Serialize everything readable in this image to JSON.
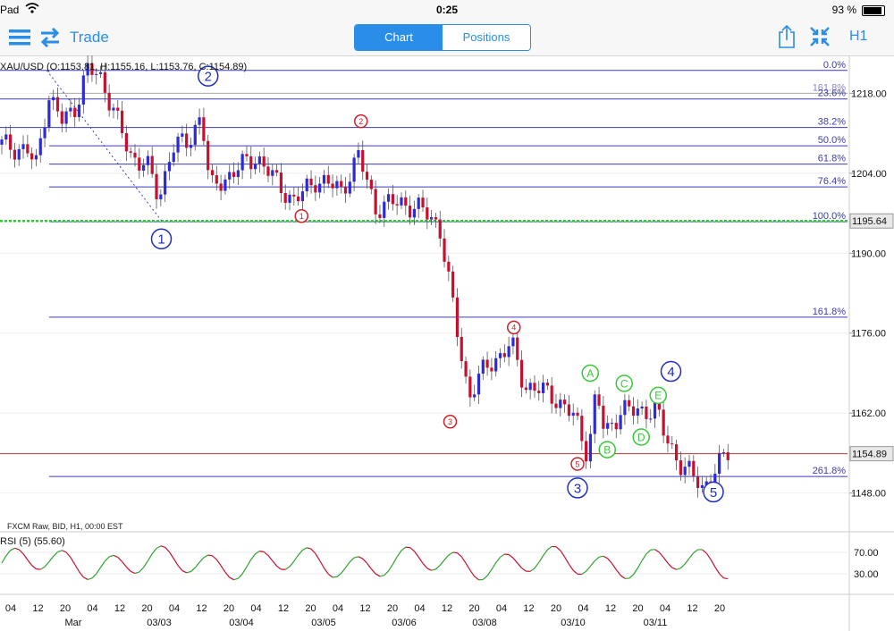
{
  "status": {
    "carrier": "Pad",
    "time": "0:25",
    "battery": "93 %"
  },
  "toolbar": {
    "trade": "Trade",
    "tab_chart": "Chart",
    "tab_positions": "Positions",
    "timeframe": "H1"
  },
  "colors": {
    "accent": "#2a8ee8",
    "fib": "#3b3bb5",
    "bull": "#2b2bd9",
    "bear": "#c8102e",
    "rsi_up": "#2ea32e",
    "rsi_down": "#c8102e",
    "wave_main": "#1f2ec2",
    "wave_minor": "#d21f2a",
    "wave_corr": "#37c837"
  },
  "chart_data": {
    "type": "candlestick",
    "instrument_label": "XAU/USD (O:1153.81, H:1155.16, L:1153.76, C:1154.89)",
    "source_label": "FXCM Raw, BID, H1, 00:00 EST",
    "ylim": [
      1142,
      1224
    ],
    "y_ticks": [
      "1218.00",
      "1204.00",
      "1190.00",
      "1176.00",
      "1162.00",
      "1148.00"
    ],
    "current_price": "1154.89",
    "green_level": "1195.64",
    "x_ticks": [
      "04",
      "12",
      "20",
      "04",
      "12",
      "20",
      "04",
      "12",
      "20",
      "04",
      "12",
      "20",
      "04",
      "12",
      "20",
      "04",
      "12",
      "20",
      "04",
      "12",
      "20",
      "04",
      "12",
      "20",
      "04",
      "12",
      "20"
    ],
    "x_dates": [
      "Mar",
      "03/03",
      "03/04",
      "03/05",
      "03/06",
      "03/08",
      "03/10",
      "03/11"
    ],
    "fib_levels": [
      {
        "label": "0.0%",
        "value": 1222.0
      },
      {
        "label": "161.8%",
        "value": 1218.0
      },
      {
        "label": "23.6%",
        "value": 1217.0
      },
      {
        "label": "38.2%",
        "value": 1212.0
      },
      {
        "label": "50.0%",
        "value": 1208.8
      },
      {
        "label": "61.8%",
        "value": 1205.6
      },
      {
        "label": "76.4%",
        "value": 1201.6
      },
      {
        "label": "100.0%",
        "value": 1195.5
      },
      {
        "label": "161.8%",
        "value": 1178.8
      },
      {
        "label": "261.8%",
        "value": 1150.9
      }
    ],
    "waves": [
      {
        "label": "1",
        "set": "main",
        "x": 0.19,
        "price": 1192.5
      },
      {
        "label": "2",
        "set": "main",
        "x": 0.245,
        "price": 1221.0
      },
      {
        "label": "3",
        "set": "main",
        "x": 0.68,
        "price": 1148.9
      },
      {
        "label": "4",
        "set": "main",
        "x": 0.79,
        "price": 1169.3
      },
      {
        "label": "5",
        "set": "main",
        "x": 0.84,
        "price": 1148.2
      },
      {
        "label": "1",
        "set": "minor",
        "x": 0.355,
        "price": 1196.5
      },
      {
        "label": "2",
        "set": "minor",
        "x": 0.425,
        "price": 1213.1
      },
      {
        "label": "3",
        "set": "minor",
        "x": 0.53,
        "price": 1160.5
      },
      {
        "label": "4",
        "set": "minor",
        "x": 0.605,
        "price": 1177.0
      },
      {
        "label": "5",
        "set": "minor",
        "x": 0.68,
        "price": 1153.1
      },
      {
        "label": "A",
        "set": "corr",
        "x": 0.695,
        "price": 1169.0
      },
      {
        "label": "B",
        "set": "corr",
        "x": 0.715,
        "price": 1155.6
      },
      {
        "label": "C",
        "set": "corr",
        "x": 0.735,
        "price": 1167.2
      },
      {
        "label": "D",
        "set": "corr",
        "x": 0.755,
        "price": 1157.8
      },
      {
        "label": "E",
        "set": "corr",
        "x": 0.775,
        "price": 1165.1
      }
    ],
    "rsi": {
      "label": "RSI (5)",
      "value": "55.60",
      "ticks": [
        "70.00",
        "30.00"
      ],
      "ylim": [
        0,
        100
      ]
    }
  }
}
